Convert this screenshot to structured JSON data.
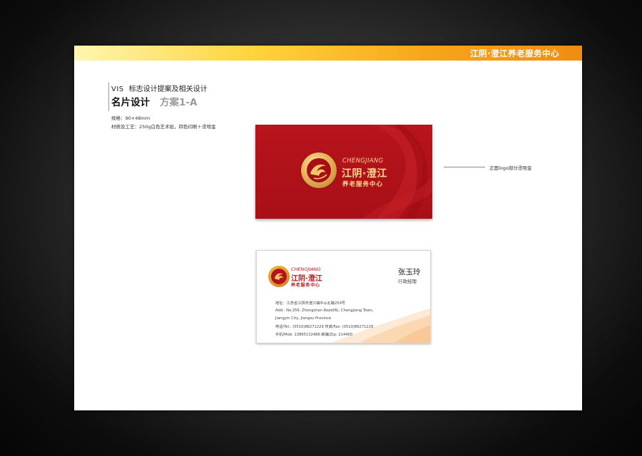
{
  "header": {
    "title": "江阴·澄江养老服务中心"
  },
  "heading": {
    "vis_tag": "VIS",
    "vis_label": "标志设计提案及相关设计",
    "title": "名片设计",
    "subtitle": "方案1-A",
    "spec_size": "规格：90×48mm",
    "spec_material": "材质及工艺：250g白色艺术纸，四色印刷＋烫哑金"
  },
  "card_front": {
    "brand_en": "CHENGJIANG",
    "brand_cn": "江阴·澄江",
    "brand_sub": "养老服务中心",
    "callout": "正面logo部分烫哑金"
  },
  "card_back": {
    "brand_en": "CHENGJIANG",
    "brand_cn": "江阴·澄江",
    "brand_sub": "养老服务中心",
    "person_name": "张玉玲",
    "person_title": "行政经理",
    "address_lines": [
      "地址：江苏省江阴市澄江镇中山北路259号",
      "Add.: No.259, Zhongshan Road(N), Chengjiang Town,",
      "Jiangyin City, Jiangsu Province",
      "电话/Tel.: (0510)86271229   传真/Fax: (0510)86271229",
      "手机/Mob: 13865132486   邮编/Zip: 214400"
    ]
  },
  "colors": {
    "card_red": "#b8141c",
    "gold": "#f9d98d",
    "bar_orange": "#f08c10"
  }
}
